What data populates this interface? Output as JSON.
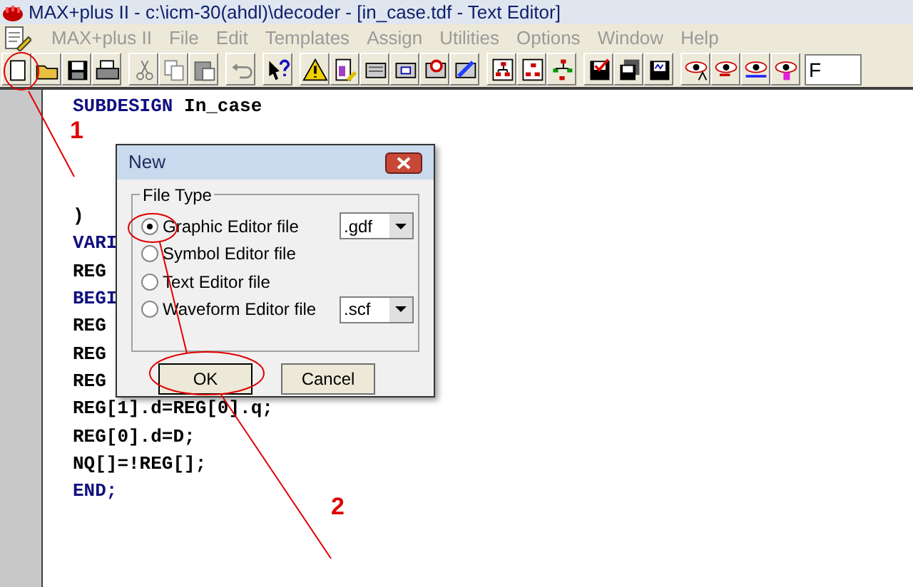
{
  "window": {
    "title": "MAX+plus II - c:\\icm-30(ahdl)\\decoder - [in_case.tdf - Text Editor]"
  },
  "menu": [
    {
      "label": "MAX+plus II",
      "disabled": true
    },
    {
      "label": "File",
      "disabled": true
    },
    {
      "label": "Edit",
      "disabled": true
    },
    {
      "label": "Templates",
      "disabled": true
    },
    {
      "label": "Assign",
      "disabled": true
    },
    {
      "label": "Utilities",
      "disabled": true
    },
    {
      "label": "Options",
      "disabled": true
    },
    {
      "label": "Window",
      "disabled": true
    },
    {
      "label": "Help",
      "disabled": true
    }
  ],
  "toolbar": {
    "field_value": "F"
  },
  "editor": {
    "lines": [
      {
        "kind": "mixed",
        "keyword": "SUBDESIGN",
        "rest": " In_case"
      },
      {
        "kind": "blank"
      },
      {
        "kind": "blank"
      },
      {
        "kind": "blank"
      },
      {
        "kind": "plain",
        "text": ")"
      },
      {
        "kind": "keyword",
        "text": "VARI"
      },
      {
        "kind": "plain",
        "text": "REG"
      },
      {
        "kind": "keyword",
        "text": "BEGI"
      },
      {
        "kind": "plain",
        "text": "REG"
      },
      {
        "kind": "plain",
        "text": "REG"
      },
      {
        "kind": "plain",
        "text": "REG"
      },
      {
        "kind": "plain",
        "text": "REG[1].d=REG[0].q;"
      },
      {
        "kind": "plain",
        "text": "REG[0].d=D;"
      },
      {
        "kind": "plain",
        "text": "NQ[]=!REG[];"
      },
      {
        "kind": "keyword",
        "text": "END;"
      }
    ]
  },
  "dialog": {
    "title": "New",
    "group": "File Type",
    "options": [
      {
        "label": "Graphic Editor file",
        "selected": true,
        "extension": ".gdf"
      },
      {
        "label": "Symbol Editor file",
        "selected": false
      },
      {
        "label": "Text Editor file",
        "selected": false
      },
      {
        "label": "Waveform Editor file",
        "selected": false,
        "extension": ".scf"
      }
    ],
    "buttons": [
      "OK",
      "Cancel"
    ]
  },
  "annotations": [
    {
      "label": "1"
    },
    {
      "label": "2"
    }
  ]
}
